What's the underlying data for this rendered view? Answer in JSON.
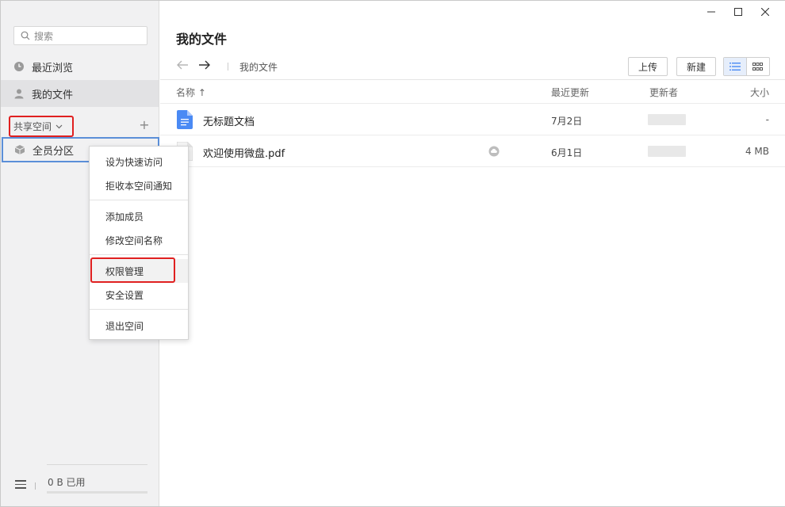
{
  "sidebar": {
    "search_placeholder": "搜索",
    "nav": [
      {
        "label": "最近浏览",
        "icon": "clock-icon"
      },
      {
        "label": "我的文件",
        "icon": "person-icon"
      }
    ],
    "shared_header": "共享空间",
    "space": {
      "label": "全员分区",
      "icon": "cube-icon"
    },
    "storage": "0 B 已用"
  },
  "main": {
    "title": "我的文件",
    "breadcrumb": "我的文件",
    "upload_label": "上传",
    "new_label": "新建",
    "columns": {
      "name": "名称 ↑",
      "updated": "最近更新",
      "updater": "更新者",
      "size": "大小"
    },
    "files": [
      {
        "name": "无标题文档",
        "date": "7月2日",
        "size": "-",
        "type": "doc"
      },
      {
        "name": "欢迎使用微盘.pdf",
        "date": "6月1日",
        "size": "4 MB",
        "type": "pdf"
      }
    ]
  },
  "context_menu": {
    "items": [
      {
        "label": "设为快速访问"
      },
      {
        "label": "拒收本空间通知"
      },
      {
        "label": "添加成员"
      },
      {
        "label": "修改空间名称"
      },
      {
        "label": "权限管理"
      },
      {
        "label": "安全设置"
      },
      {
        "label": "退出空间"
      }
    ]
  },
  "colors": {
    "accent": "#4a8af4",
    "highlight_box": "#e02020",
    "sidebar_bg": "#f1f1f2"
  }
}
